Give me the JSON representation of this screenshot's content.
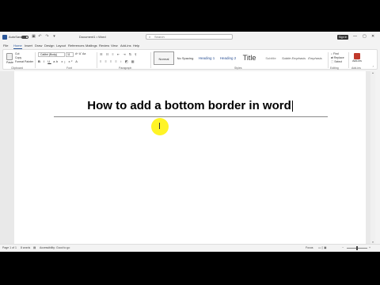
{
  "titlebar": {
    "autosave_label": "AutoSave",
    "toggle_state": "Off",
    "document_title": "Document1 • Word",
    "search_placeholder": "Search",
    "signin_label": "Sign in",
    "minimize": "—",
    "maximize": "▢",
    "close": "✕"
  },
  "tabs": [
    "File",
    "Home",
    "Insert",
    "Draw",
    "Design",
    "Layout",
    "References",
    "Mailings",
    "Review",
    "View",
    "Add-ins",
    "Help"
  ],
  "ribbon": {
    "clipboard": {
      "paste": "Paste",
      "cut": "Cut",
      "copy": "Copy",
      "format_painter": "Format Painter",
      "label": "Clipboard"
    },
    "font": {
      "family": "Calibri (Body)",
      "size": "11",
      "label": "Font"
    },
    "paragraph": {
      "label": "Paragraph"
    },
    "styles": {
      "items": [
        "Normal",
        "No Spacing",
        "Heading 1",
        "Heading 2",
        "Title",
        "Subtitle",
        "Subtle Emphasis",
        "Emphasis"
      ],
      "label": "Styles"
    },
    "editing": {
      "find": "Find",
      "replace": "Replace",
      "select": "Select",
      "label": "Editing"
    },
    "addins": {
      "label": "Add-ins",
      "group_label": "Add-ins"
    }
  },
  "document": {
    "heading": "How to add a bottom border in word"
  },
  "statusbar": {
    "page": "Page 1 of 1",
    "words": "8 words",
    "accessibility": "Accessibility: Good to go",
    "focus": "Focus"
  }
}
